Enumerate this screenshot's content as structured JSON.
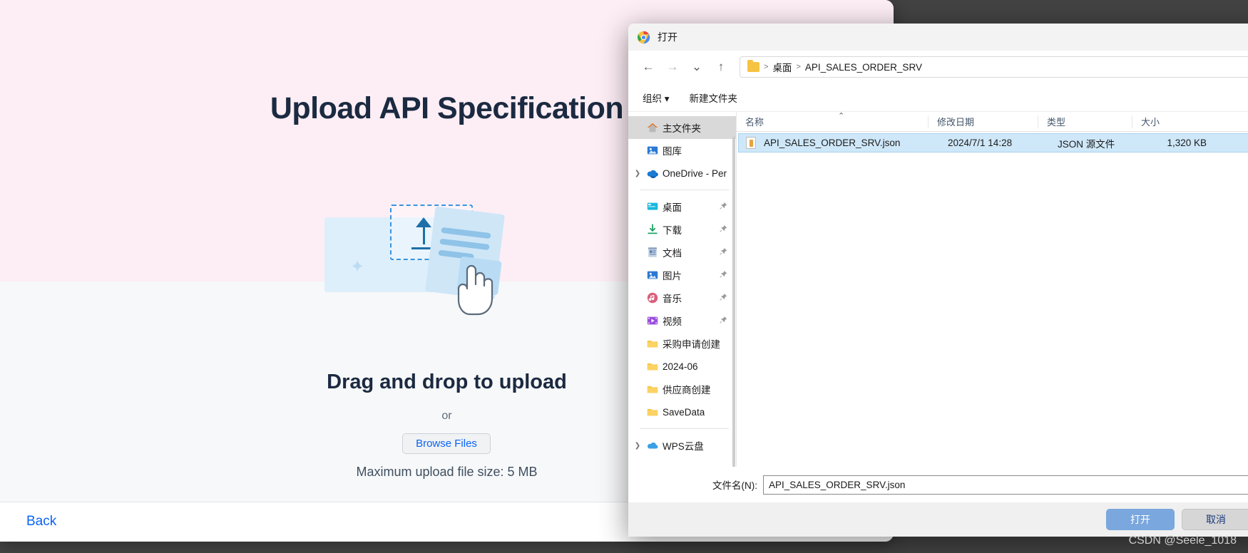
{
  "app": {
    "title": "Upload API Specification",
    "drag_title": "Drag and drop to upload",
    "or_text": "or",
    "browse_label": "Browse Files",
    "max_size_text": "Maximum upload file size: 5 MB",
    "back_label": "Back"
  },
  "dialog": {
    "title": "打开",
    "nav": {
      "back": "←",
      "forward": "→",
      "recent": "⌄",
      "up": "↑"
    },
    "breadcrumb": [
      "桌面",
      "API_SALES_ORDER_SRV"
    ],
    "commands": {
      "organize": "组织",
      "organize_caret": "▾",
      "new_folder": "新建文件夹"
    },
    "sidebar": [
      {
        "label": "主文件夹",
        "icon": "home-icon",
        "selected": true,
        "chevron": false,
        "pinned": false
      },
      {
        "label": "图库",
        "icon": "gallery-icon",
        "selected": false,
        "chevron": false,
        "pinned": false
      },
      {
        "label": "OneDrive - Per",
        "icon": "onedrive-icon",
        "selected": false,
        "chevron": true,
        "pinned": false
      },
      {
        "divider": true
      },
      {
        "label": "桌面",
        "icon": "desktop-icon",
        "selected": false,
        "chevron": false,
        "pinned": true
      },
      {
        "label": "下载",
        "icon": "download-icon",
        "selected": false,
        "chevron": false,
        "pinned": true
      },
      {
        "label": "文档",
        "icon": "documents-icon",
        "selected": false,
        "chevron": false,
        "pinned": true
      },
      {
        "label": "图片",
        "icon": "pictures-icon",
        "selected": false,
        "chevron": false,
        "pinned": true
      },
      {
        "label": "音乐",
        "icon": "music-icon",
        "selected": false,
        "chevron": false,
        "pinned": true
      },
      {
        "label": "视频",
        "icon": "videos-icon",
        "selected": false,
        "chevron": false,
        "pinned": true
      },
      {
        "label": "采购申请创建",
        "icon": "folder-icon",
        "selected": false,
        "chevron": false,
        "pinned": false
      },
      {
        "label": "2024-06",
        "icon": "folder-icon",
        "selected": false,
        "chevron": false,
        "pinned": false
      },
      {
        "label": "供应商创建",
        "icon": "folder-icon",
        "selected": false,
        "chevron": false,
        "pinned": false
      },
      {
        "label": "SaveData",
        "icon": "folder-icon",
        "selected": false,
        "chevron": false,
        "pinned": false
      },
      {
        "divider": true
      },
      {
        "label": "WPS云盘",
        "icon": "wps-cloud-icon",
        "selected": false,
        "chevron": true,
        "pinned": false
      }
    ],
    "columns": [
      "名称",
      "修改日期",
      "类型",
      "大小"
    ],
    "files": [
      {
        "name": "API_SALES_ORDER_SRV.json",
        "modified": "2024/7/1 14:28",
        "type": "JSON 源文件",
        "size": "1,320 KB",
        "selected": true
      }
    ],
    "filename_label": "文件名(N):",
    "filename_value": "API_SALES_ORDER_SRV.json",
    "open_label": "打开",
    "cancel_label": "取消"
  },
  "watermark": "CSDN @Seele_1018"
}
